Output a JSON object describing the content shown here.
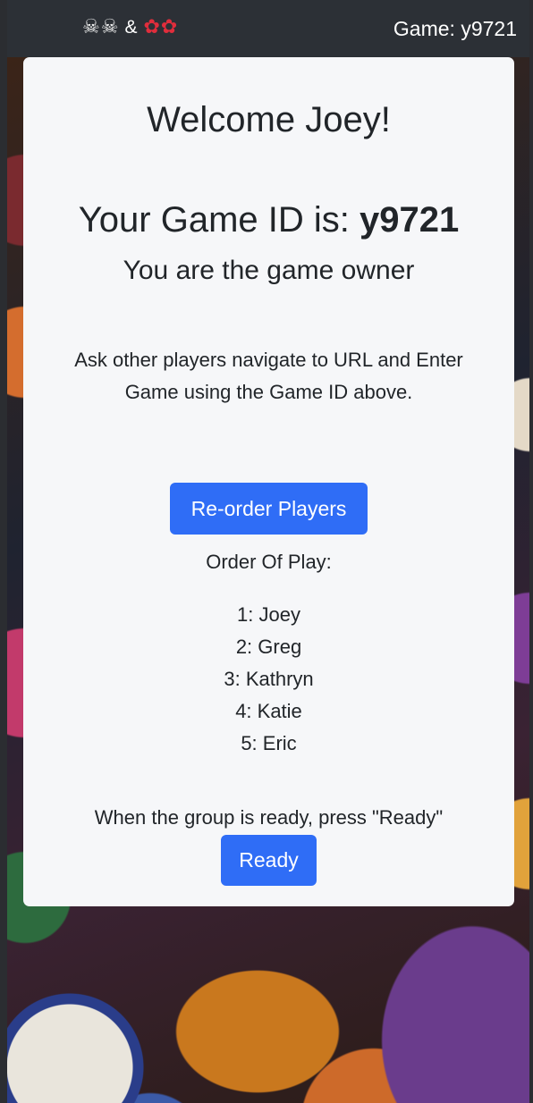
{
  "header": {
    "brand": {
      "left_icons": [
        "skull-icon",
        "skull-icon"
      ],
      "separator": "&",
      "right_icons": [
        "rose-icon",
        "rose-icon"
      ]
    },
    "game_label": "Game: y9721"
  },
  "card": {
    "welcome": "Welcome Joey!",
    "game_id_prefix": "Your Game ID is: ",
    "game_id": "y9721",
    "owner_text": "You are the game owner",
    "instructions": "Ask other players navigate to URL and Enter Game using the Game ID above.",
    "reorder_button": "Re-order Players",
    "order_label": "Order Of Play:",
    "players": [
      "1: Joey",
      "2: Greg",
      "3: Kathryn",
      "4: Katie",
      "5: Eric"
    ],
    "ready_instruction": "When the group is ready, press \"Ready\"",
    "ready_button": "Ready"
  },
  "colors": {
    "topbar": "#2c3036",
    "card_bg": "#f6f7f9",
    "button_primary": "#2f6df6",
    "text": "#212529"
  }
}
